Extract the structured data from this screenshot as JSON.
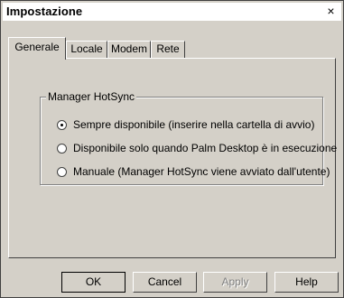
{
  "window": {
    "title": "Impostazione",
    "close_glyph": "×"
  },
  "tabs": [
    {
      "label": "Generale",
      "active": true
    },
    {
      "label": "Locale",
      "active": false
    },
    {
      "label": "Modem",
      "active": false
    },
    {
      "label": "Rete",
      "active": false
    }
  ],
  "group": {
    "label": "Manager HotSync",
    "options": [
      {
        "label": "Sempre disponibile (inserire nella cartella di avvio)",
        "checked": true
      },
      {
        "label": "Disponibile solo quando Palm Desktop è in esecuzione",
        "checked": false
      },
      {
        "label": "Manuale (Manager HotSync viene avviato dall'utente)",
        "checked": false
      }
    ]
  },
  "buttons": {
    "ok": "OK",
    "cancel": "Cancel",
    "apply": "Apply",
    "help": "Help"
  },
  "colors": {
    "face": "#d4d0c8",
    "title_background": "#ffffff"
  }
}
